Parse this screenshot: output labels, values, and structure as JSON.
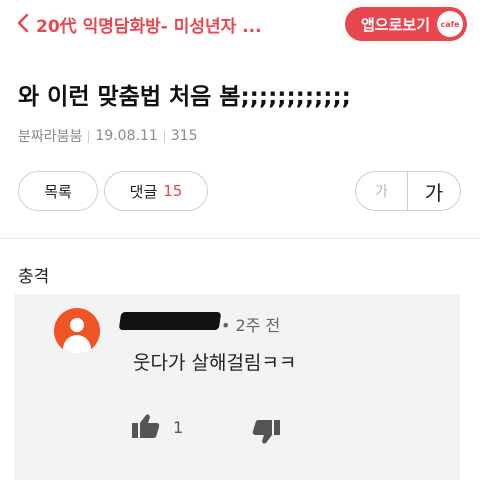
{
  "header": {
    "cafe_title": "20代 익명담화방- 미성년자 ...",
    "app_button_label": "앱으로보기",
    "app_badge": "cafe"
  },
  "post": {
    "title": "와 이런 맞춤법 처음 봄;;;;;;;;;;;;",
    "author": "분짜라붐붐",
    "date": "19.08.11",
    "views": "315",
    "body": "충격"
  },
  "actions": {
    "list_label": "목록",
    "comment_label": "댓글",
    "comment_count": "15",
    "font_small": "가",
    "font_large": "가"
  },
  "comment": {
    "time": "• 2주 전",
    "text": "웃다가 살해걸림ㅋㅋ",
    "like_count": "1"
  },
  "colors": {
    "accent": "#e8474e",
    "avatar": "#ef5424"
  }
}
